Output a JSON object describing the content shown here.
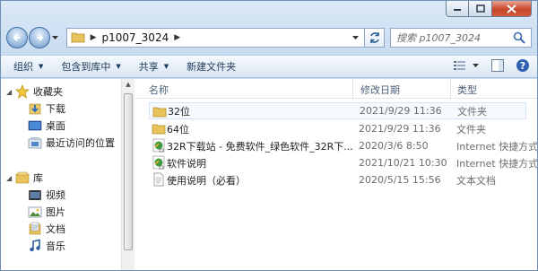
{
  "address": {
    "crumb": "p1007_3024"
  },
  "search": {
    "placeholder": "搜索 p1007_3024"
  },
  "toolbar": {
    "organize": "组织",
    "include_in_library": "包含到库中",
    "share": "共享",
    "new_folder": "新建文件夹"
  },
  "columns": {
    "name": "名称",
    "date": "修改日期",
    "type": "类型"
  },
  "sidebar": {
    "favorites": "收藏夹",
    "favorites_items": [
      {
        "label": "下载",
        "icon": "download-icon"
      },
      {
        "label": "桌面",
        "icon": "desktop-icon"
      },
      {
        "label": "最近访问的位置",
        "icon": "recent-places-icon"
      }
    ],
    "libraries": "库",
    "libraries_items": [
      {
        "label": "视频",
        "icon": "video-icon"
      },
      {
        "label": "图片",
        "icon": "pictures-icon"
      },
      {
        "label": "文档",
        "icon": "documents-icon"
      },
      {
        "label": "音乐",
        "icon": "music-icon"
      }
    ]
  },
  "files": [
    {
      "name": "32位",
      "date": "2021/9/29 11:36",
      "type": "文件夹",
      "icon": "folder-icon"
    },
    {
      "name": "64位",
      "date": "2021/9/29 11:36",
      "type": "文件夹",
      "icon": "folder-icon"
    },
    {
      "name": "32R下载站 - 免费软件_绿色软件_32R下...",
      "date": "2020/3/6 8:50",
      "type": "Internet 快捷方式",
      "icon": "internet-shortcut-icon"
    },
    {
      "name": "软件说明",
      "date": "2021/10/21 10:30",
      "type": "Internet 快捷方式",
      "icon": "internet-shortcut-icon"
    },
    {
      "name": "使用说明（必看）",
      "date": "2020/5/15 15:56",
      "type": "文本文档",
      "icon": "text-document-icon"
    }
  ],
  "colors": {
    "folder": "#e8c25a",
    "accent": "#1e395b"
  }
}
